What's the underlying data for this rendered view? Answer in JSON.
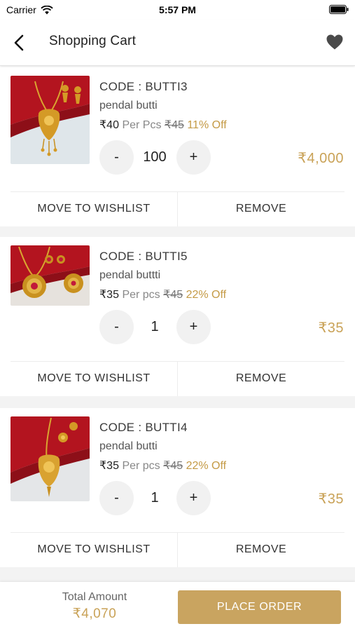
{
  "status_bar": {
    "carrier": "Carrier",
    "time": "5:57 PM"
  },
  "header": {
    "title": "Shopping Cart"
  },
  "currency": "₹",
  "items": [
    {
      "code": "CODE : BUTTI3",
      "name": "pendal  butti",
      "price": "₹40",
      "unit": "Per Pcs",
      "mrp": "₹45",
      "discount": "11% Off",
      "qty": "100",
      "minus": "-",
      "plus": "+",
      "total": "₹4,000",
      "wishlist_label": "MOVE TO WISHLIST",
      "remove_label": "REMOVE"
    },
    {
      "code": "CODE : BUTTI5",
      "name": "pendal buttti",
      "price": "₹35",
      "unit": "Per pcs",
      "mrp": "₹45",
      "discount": "22% Off",
      "qty": "1",
      "minus": "-",
      "plus": "+",
      "total": "₹35",
      "wishlist_label": "MOVE TO WISHLIST",
      "remove_label": "REMOVE"
    },
    {
      "code": "CODE : BUTTI4",
      "name": "pendal  butti",
      "price": "₹35",
      "unit": "Per pcs",
      "mrp": "₹45",
      "discount": "22% Off",
      "qty": "1",
      "minus": "-",
      "plus": "+",
      "total": "₹35",
      "wishlist_label": "MOVE TO WISHLIST",
      "remove_label": "REMOVE"
    }
  ],
  "footer": {
    "total_label": "Total Amount",
    "total_value": "₹4,070",
    "place_order_label": "PLACE ORDER"
  },
  "colors": {
    "accent": "#c9a460",
    "price_gold": "#c9a257",
    "thumb_red": "#b3141f"
  },
  "icons": {
    "back": "chevron-left-icon",
    "wishlist": "heart-icon",
    "wifi": "wifi-icon",
    "battery": "battery-icon"
  }
}
